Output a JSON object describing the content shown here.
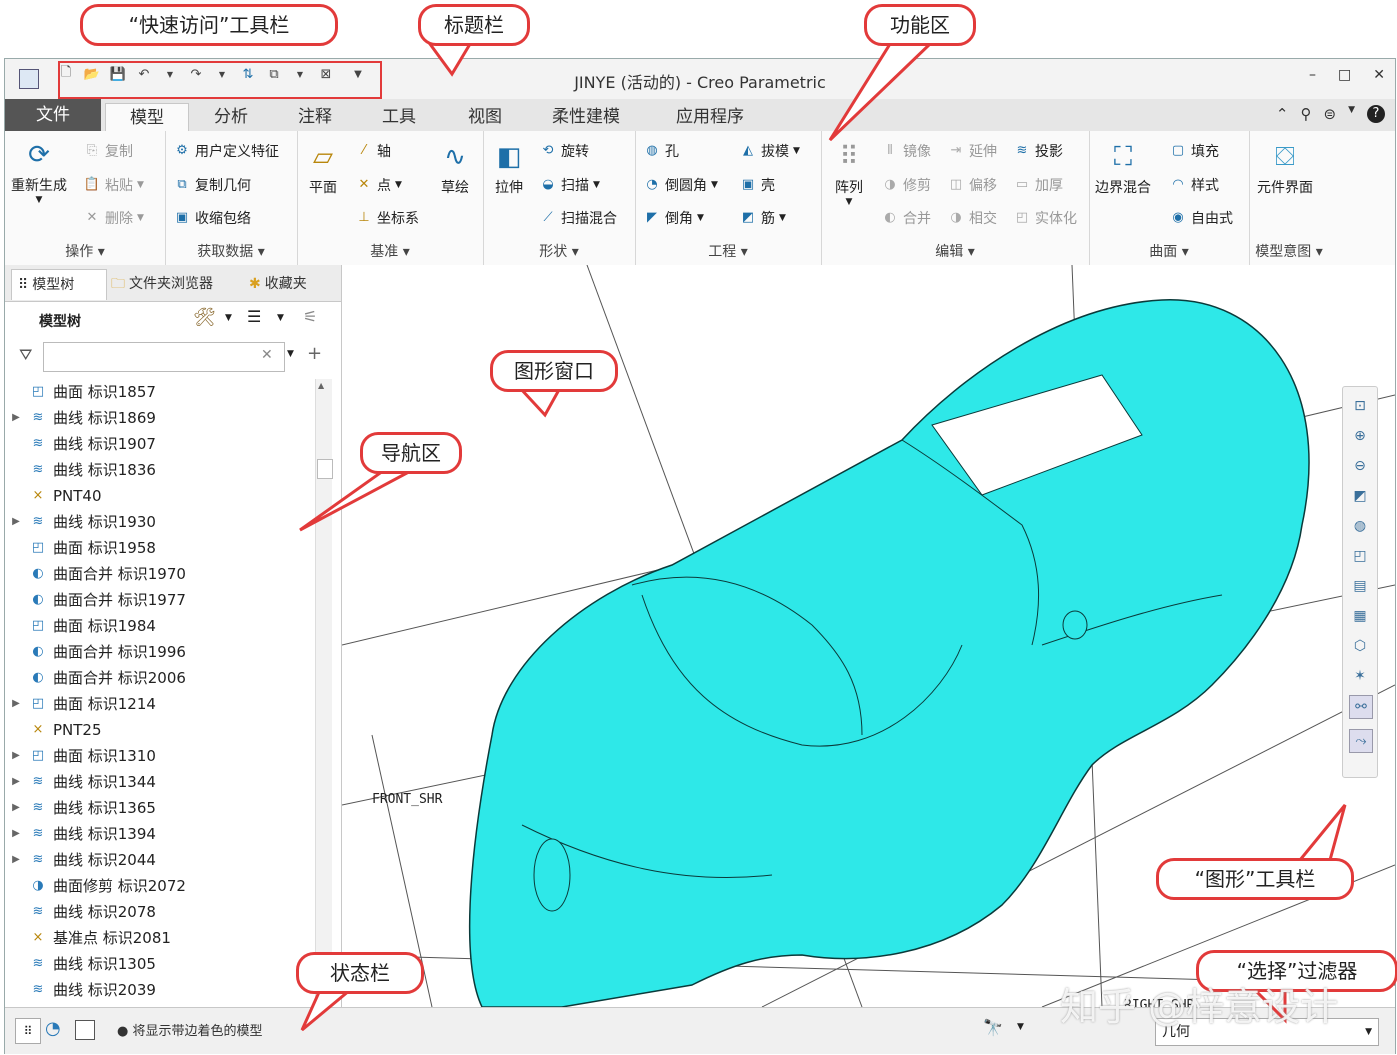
{
  "window": {
    "title": "JINYE (活动的) - Creo Parametric",
    "controls": [
      "–",
      "□",
      "✕"
    ]
  },
  "tabs": [
    {
      "label": "文件"
    },
    {
      "label": "模型"
    },
    {
      "label": "分析"
    },
    {
      "label": "注释"
    },
    {
      "label": "工具"
    },
    {
      "label": "视图"
    },
    {
      "label": "柔性建模"
    },
    {
      "label": "应用程序"
    }
  ],
  "ribbon": {
    "operations": {
      "label": "操作 ▾",
      "regenerate": "重新生成",
      "copy": "复制",
      "paste": "粘贴",
      "delete": "删除"
    },
    "get_data": {
      "label": "获取数据 ▾",
      "udf": "用户定义特征",
      "copy_geom": "复制几何",
      "shrinkwrap": "收缩包络"
    },
    "datum": {
      "label": "基准 ▾",
      "plane": "平面",
      "axis": "轴",
      "point": "点",
      "csys": "坐标系",
      "sketch": "草绘"
    },
    "shapes": {
      "label": "形状 ▾",
      "extrude": "拉伸",
      "revolve": "旋转",
      "sweep": "扫描",
      "swept_blend": "扫描混合"
    },
    "engineering": {
      "label": "工程 ▾",
      "hole": "孔",
      "round": "倒圆角",
      "chamfer": "倒角",
      "draft": "拔模",
      "shell": "壳",
      "rib": "筋"
    },
    "editing": {
      "label": "编辑 ▾",
      "pattern": "阵列",
      "mirror": "镜像",
      "trim": "修剪",
      "merge": "合并",
      "extend": "延伸",
      "offset": "偏移",
      "intersect": "相交",
      "project": "投影",
      "thicken": "加厚",
      "solidify": "实体化"
    },
    "surfaces": {
      "label": "曲面 ▾",
      "boundary_blend": "边界混合",
      "fill": "填充",
      "style": "样式",
      "freestyle": "自由式"
    },
    "model_intent": {
      "label": "模型意图 ▾",
      "component_interface": "元件界面"
    }
  },
  "nav": {
    "tabs": [
      "模型树",
      "文件夹浏览器",
      "收藏夹"
    ],
    "tree_title": "模型树",
    "search_placeholder": "",
    "items": [
      {
        "label": "曲面 标识1857",
        "expandable": false,
        "icon": "surface-icon"
      },
      {
        "label": "曲线 标识1869",
        "expandable": true,
        "icon": "curve-icon"
      },
      {
        "label": "曲线 标识1907",
        "expandable": false,
        "icon": "curve-icon"
      },
      {
        "label": "曲线 标识1836",
        "expandable": false,
        "icon": "curve-icon"
      },
      {
        "label": "PNT40",
        "expandable": false,
        "icon": "datum-point-icon"
      },
      {
        "label": "曲线 标识1930",
        "expandable": true,
        "icon": "curve-icon"
      },
      {
        "label": "曲面 标识1958",
        "expandable": false,
        "icon": "surface-icon"
      },
      {
        "label": "曲面合并 标识1970",
        "expandable": false,
        "icon": "merge-icon"
      },
      {
        "label": "曲面合并 标识1977",
        "expandable": false,
        "icon": "merge-icon"
      },
      {
        "label": "曲面 标识1984",
        "expandable": false,
        "icon": "surface-icon"
      },
      {
        "label": "曲面合并 标识1996",
        "expandable": false,
        "icon": "merge-icon"
      },
      {
        "label": "曲面合并 标识2006",
        "expandable": false,
        "icon": "merge-icon"
      },
      {
        "label": "曲面 标识1214",
        "expandable": true,
        "icon": "surface-icon"
      },
      {
        "label": "PNT25",
        "expandable": false,
        "icon": "datum-point-icon"
      },
      {
        "label": "曲面 标识1310",
        "expandable": true,
        "icon": "surface-icon"
      },
      {
        "label": "曲线 标识1344",
        "expandable": true,
        "icon": "curve-icon"
      },
      {
        "label": "曲线 标识1365",
        "expandable": true,
        "icon": "curve-icon"
      },
      {
        "label": "曲线 标识1394",
        "expandable": true,
        "icon": "curve-icon"
      },
      {
        "label": "曲线 标识2044",
        "expandable": true,
        "icon": "curve-icon"
      },
      {
        "label": "曲面修剪 标识2072",
        "expandable": false,
        "icon": "trim-icon"
      },
      {
        "label": "曲线 标识2078",
        "expandable": false,
        "icon": "curve-icon"
      },
      {
        "label": "基准点 标识2081",
        "expandable": false,
        "icon": "datum-point-icon"
      },
      {
        "label": "曲线 标识1305",
        "expandable": false,
        "icon": "curve-icon"
      },
      {
        "label": "曲线 标识2039",
        "expandable": false,
        "icon": "curve-icon"
      }
    ]
  },
  "graphics": {
    "front_label": "FRONT_SHR",
    "right_label": "RIGHT_SHR",
    "model_color": "#2ee8e8"
  },
  "status": {
    "message": "将显示带边着色的模型",
    "filter_value": "几何"
  },
  "callouts": {
    "quick_access": "“快速访问”工具栏",
    "title_bar": "标题栏",
    "ribbon": "功能区",
    "graphics_window": "图形窗口",
    "navigator": "导航区",
    "graphics_toolbar": "“图形”工具栏",
    "status_bar": "状态栏",
    "selection_filter": "“选择”过滤器"
  },
  "watermark": "知乎 @梓意设计",
  "colors": {
    "accent": "#e23a3a",
    "model": "#2ee8e8",
    "file_tab": "#555555"
  }
}
